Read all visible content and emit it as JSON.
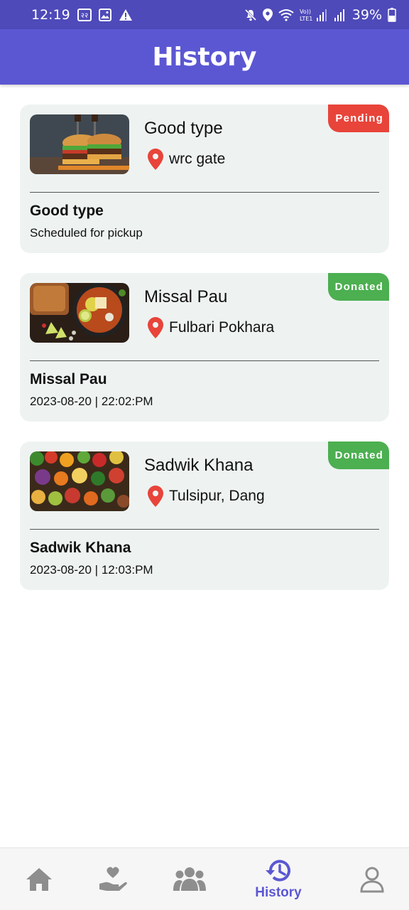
{
  "status_bar": {
    "time": "12:19",
    "battery": "39%"
  },
  "app_bar": {
    "title": "History"
  },
  "items": [
    {
      "title": "Good type",
      "location": "wrc gate",
      "subtitle": "Good type",
      "detail": "Scheduled for pickup",
      "status": "Pending",
      "status_color": "#E8443A"
    },
    {
      "title": "Missal Pau",
      "location": "Fulbari Pokhara",
      "subtitle": "Missal Pau",
      "detail": "2023-08-20 | 22:02:PM",
      "status": "Donated",
      "status_color": "#4CAF50"
    },
    {
      "title": "Sadwik Khana",
      "location": "Tulsipur, Dang",
      "subtitle": "Sadwik Khana",
      "detail": "2023-08-20 | 12:03:PM",
      "status": "Donated",
      "status_color": "#4CAF50"
    }
  ],
  "bottom_nav": {
    "active_label": "History",
    "icons": [
      "home-icon",
      "donate-icon",
      "community-icon",
      "history-icon",
      "profile-icon"
    ]
  },
  "colors": {
    "primary": "#5B57D3",
    "status_bar": "#4E4AB9",
    "card_bg": "#EEF3F2",
    "pin": "#E8443A",
    "nav_inactive": "#8E8E8E"
  }
}
